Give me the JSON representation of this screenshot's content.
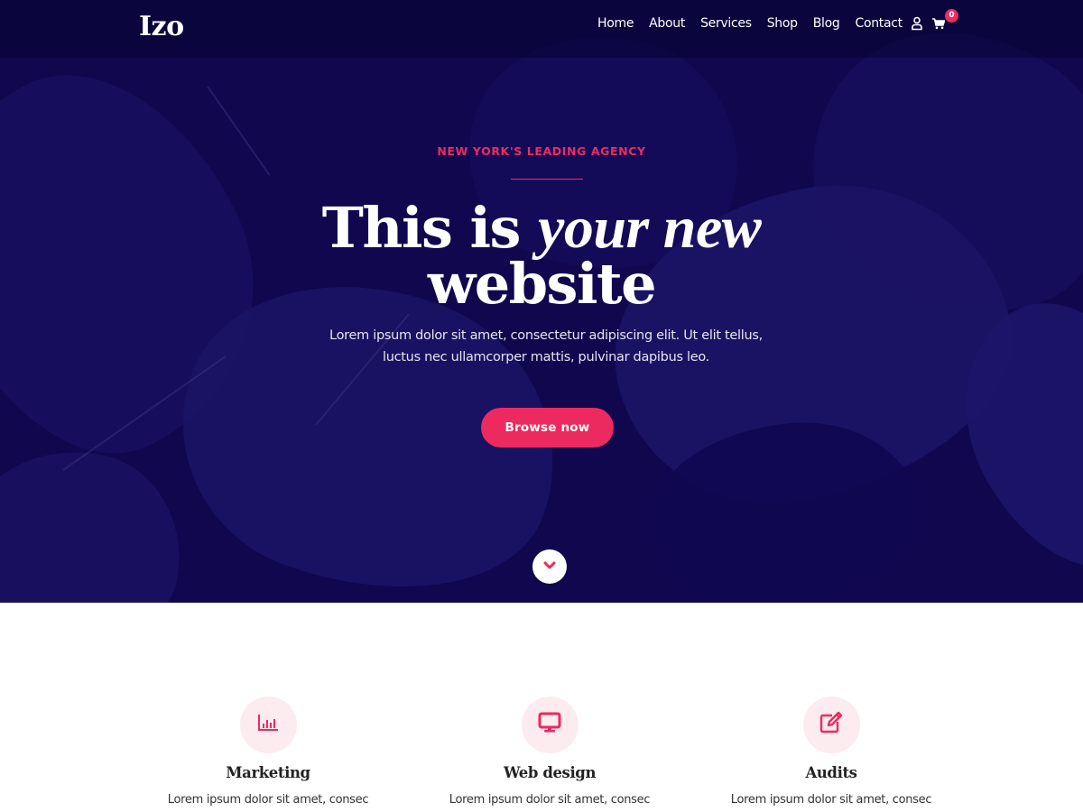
{
  "header": {
    "logo": "Izo",
    "nav": [
      {
        "label": "Home"
      },
      {
        "label": "About"
      },
      {
        "label": "Services"
      },
      {
        "label": "Shop"
      },
      {
        "label": "Blog"
      },
      {
        "label": "Contact"
      }
    ],
    "icons": {
      "account": "user-icon",
      "cart": "cart-icon"
    },
    "cart_count": "0"
  },
  "hero": {
    "eyebrow": "NEW YORK'S LEADING AGENCY",
    "headline_plain": "This is ",
    "headline_italic": "your new",
    "headline_line2": "website",
    "subtext": "Lorem ipsum dolor sit amet, consectetur adipiscing elit. Ut elit tellus, luctus nec ullamcorper mattis, pulvinar dapibus leo.",
    "cta_label": "Browse now",
    "scroll_icon": "chevron-down-icon"
  },
  "features": [
    {
      "icon": "bar-chart-icon",
      "title": "Marketing",
      "text": "Lorem ipsum dolor sit amet, consec"
    },
    {
      "icon": "monitor-icon",
      "title": "Web design",
      "text": "Lorem ipsum dolor sit amet, consec"
    },
    {
      "icon": "edit-icon",
      "title": "Audits",
      "text": "Lorem ipsum dolor sit amet, consec"
    }
  ],
  "colors": {
    "accent": "#ed2a5f",
    "hero_bg": "#10074f",
    "icon_circle_bg": "#fcebef",
    "text_dark": "#222222"
  }
}
